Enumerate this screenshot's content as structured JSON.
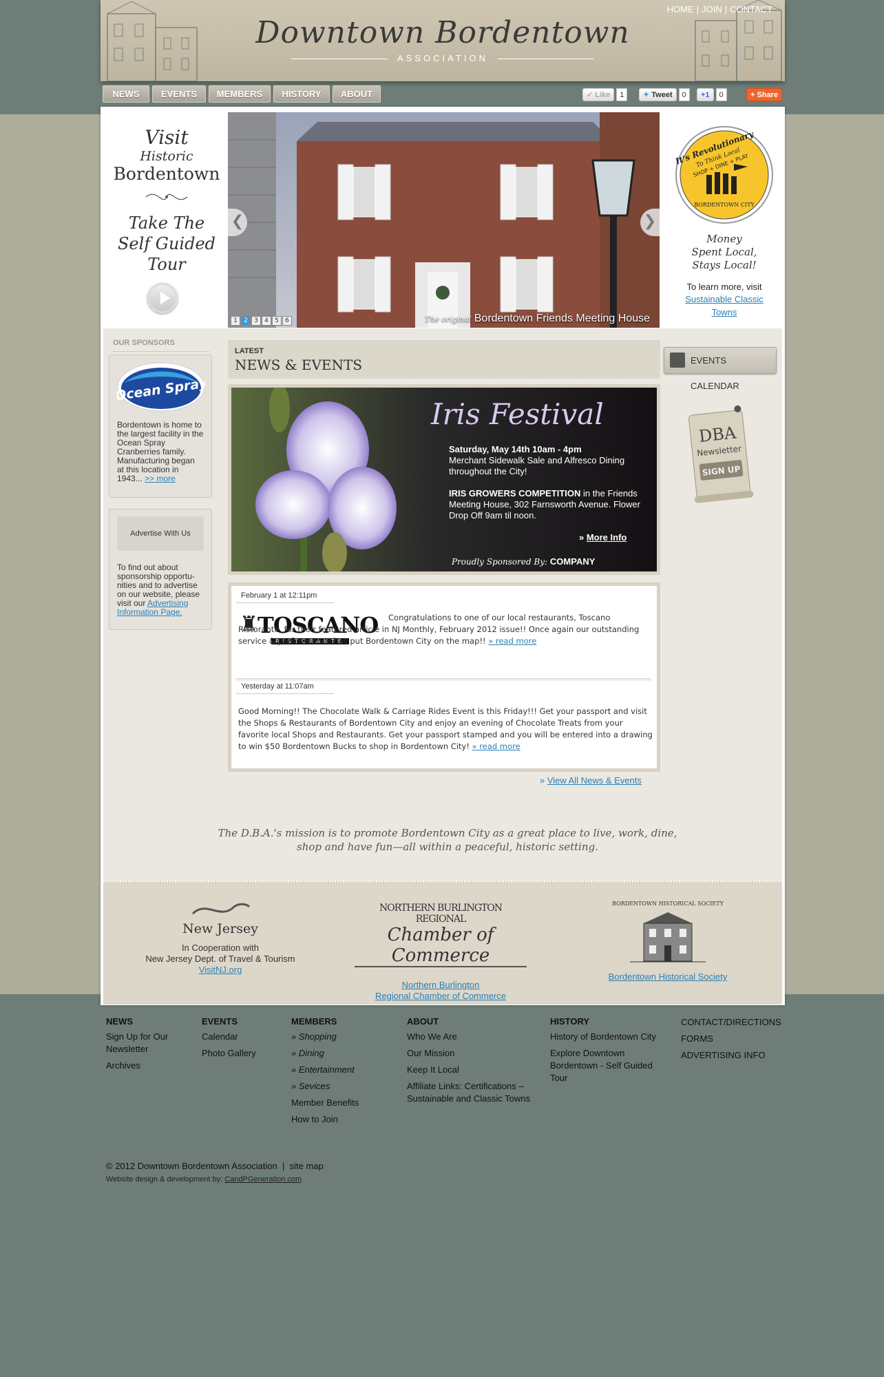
{
  "header": {
    "title": "Downtown Bordentown",
    "subtitle": "ASSOCIATION",
    "top_links": [
      "HOME",
      "JOIN",
      "CONTACT"
    ]
  },
  "nav": {
    "items": [
      "NEWS",
      "EVENTS",
      "MEMBERS",
      "HISTORY",
      "ABOUT"
    ]
  },
  "social": {
    "like_label": "Like",
    "like_count": "1",
    "tweet_label": "Tweet",
    "tweet_count": "0",
    "plusone_label": "+1",
    "plusone_count": "0",
    "share_label": "Share"
  },
  "hero": {
    "visit_line1": "Visit",
    "visit_line2": "Historic",
    "visit_line3": "Bordentown",
    "tour_line1": "Take The",
    "tour_line2": "Self Guided",
    "tour_line3": "Tour",
    "caption_prefix": "The original",
    "caption": "Bordentown Friends Meeting House",
    "pages": [
      "1",
      "2",
      "3",
      "4",
      "5",
      "6"
    ],
    "active_page": "2",
    "prev_glyph": "❮",
    "next_glyph": "❯"
  },
  "local": {
    "badge_line1": "It's Revolutionary",
    "badge_line2": "To Think Local",
    "badge_line3": "SHOP + DINE + PLAY",
    "badge_line4": "BORDENTOWN CITY",
    "slogan1": "Money",
    "slogan2": "Spent Local,",
    "slogan3": "Stays Local!",
    "learn": "To learn more, visit",
    "link": "Sustainable Classic Towns"
  },
  "sponsors": {
    "label": "OUR SPONSORS",
    "ocean_logo": "Ocean Spray",
    "ocean_text": "Bordentown is home to the largest facility in the Ocean Spray Cranberries family. Manufacturing began at this location in 1943...",
    "ocean_more": ">> more",
    "advertise_btn": "Advertise With Us",
    "advertise_text": "To find out about sponsorship opportu-nities and to advertise on our website, please visit our",
    "advertise_link": "Advertising Information Page."
  },
  "news": {
    "latest": "LATEST",
    "heading": "NEWS & EVENTS",
    "iris_title": "Iris Festival",
    "iris_date": "Saturday, May 14th 10am - 4pm",
    "iris_line1": "Merchant Sidewalk Sale and Alfresco Dining throughout the City!",
    "iris_comp": "IRIS GROWERS COMPETITION",
    "iris_line2": "in the Friends Meeting House, 302 Farnsworth Avenue. Flower Drop Off 9am til noon.",
    "iris_more": "More Info",
    "iris_spons": "Proudly Sponsored By:",
    "iris_company": "COMPANY",
    "post1_date": "February 1 at 12:11pm",
    "post1_logo": "TOSCANO",
    "post1_logo_sub": "RISTORANTE",
    "post1_text": "Congratulations to one of our local restaurants, Toscano Ristorante, for their featured article in NJ Monthly, February 2012 issue!! Once again our outstanding service & perfor-mance has put Bordentown City on the map!!",
    "post1_more": "read more",
    "post2_date": "Yesterday at 11:07am",
    "post2_text": "Good Morning!! The Chocolate Walk & Carriage Rides Event is this Friday!!! Get your passport and visit the Shops & Restaurants of Bordentown City and enjoy an evening of Chocolate Treats from your favorite local Shops and Restaurants. Get your passport stamped and you will be entered into a drawing to win $50 Bordentown Bucks to shop in Bordentown City!",
    "post2_more": "read more",
    "view_all": "View All News & Events"
  },
  "right": {
    "events_calendar": "EVENTS CALENDAR",
    "dba_line1": "DBA",
    "dba_line2": "Newsletter",
    "dba_signup": "SIGN UP"
  },
  "mission": "The D.B.A.'s mission is to promote Bordentown City as a great place to live, work, dine, shop and have fun—all within a peaceful, historic setting.",
  "partners": {
    "nj_logo": "New Jersey",
    "nj_line1": "In Cooperation with",
    "nj_line2": "New Jersey Dept. of Travel & Tourism",
    "nj_link": "VisitNJ.org",
    "chamber_logo1": "NORTHERN BURLINGTON REGIONAL",
    "chamber_logo2": "Chamber of Commerce",
    "chamber_link1": "Northern Burlington",
    "chamber_link2": "Regional Chamber of Commerce",
    "hist_logo": "BORDENTOWN HISTORICAL SOCIETY",
    "hist_link": "Bordentown Historical Society"
  },
  "footer": {
    "col1": {
      "heading": "NEWS",
      "items": [
        "Sign Up for Our Newsletter",
        "Archives"
      ]
    },
    "col2": {
      "heading": "EVENTS",
      "items": [
        "Calendar",
        "Photo Gallery"
      ]
    },
    "col3": {
      "heading": "MEMBERS",
      "items": [
        "Shopping",
        "Dining",
        "Entertainment",
        "Sevices",
        "Member Benefits",
        "How to Join"
      ]
    },
    "col4": {
      "heading": "ABOUT",
      "items": [
        "Who We Are",
        "Our Mission",
        "Keep It Local",
        "Affiliate Links: Certifications – Sustainable and Classic Towns"
      ]
    },
    "col5": {
      "heading": "HISTORY",
      "items": [
        "History of Bordentown City",
        "Explore Downtown Bordentown - Self Guided Tour"
      ]
    },
    "col6": {
      "items": [
        "CONTACT/DIRECTIONS",
        "FORMS",
        "ADVERTISING INFO"
      ]
    },
    "copyright": "© 2012 Downtown Bordentown Association",
    "sitemap": "site map",
    "credit": "Website design & development by:",
    "credit_link": "CandPGeneration.com"
  }
}
